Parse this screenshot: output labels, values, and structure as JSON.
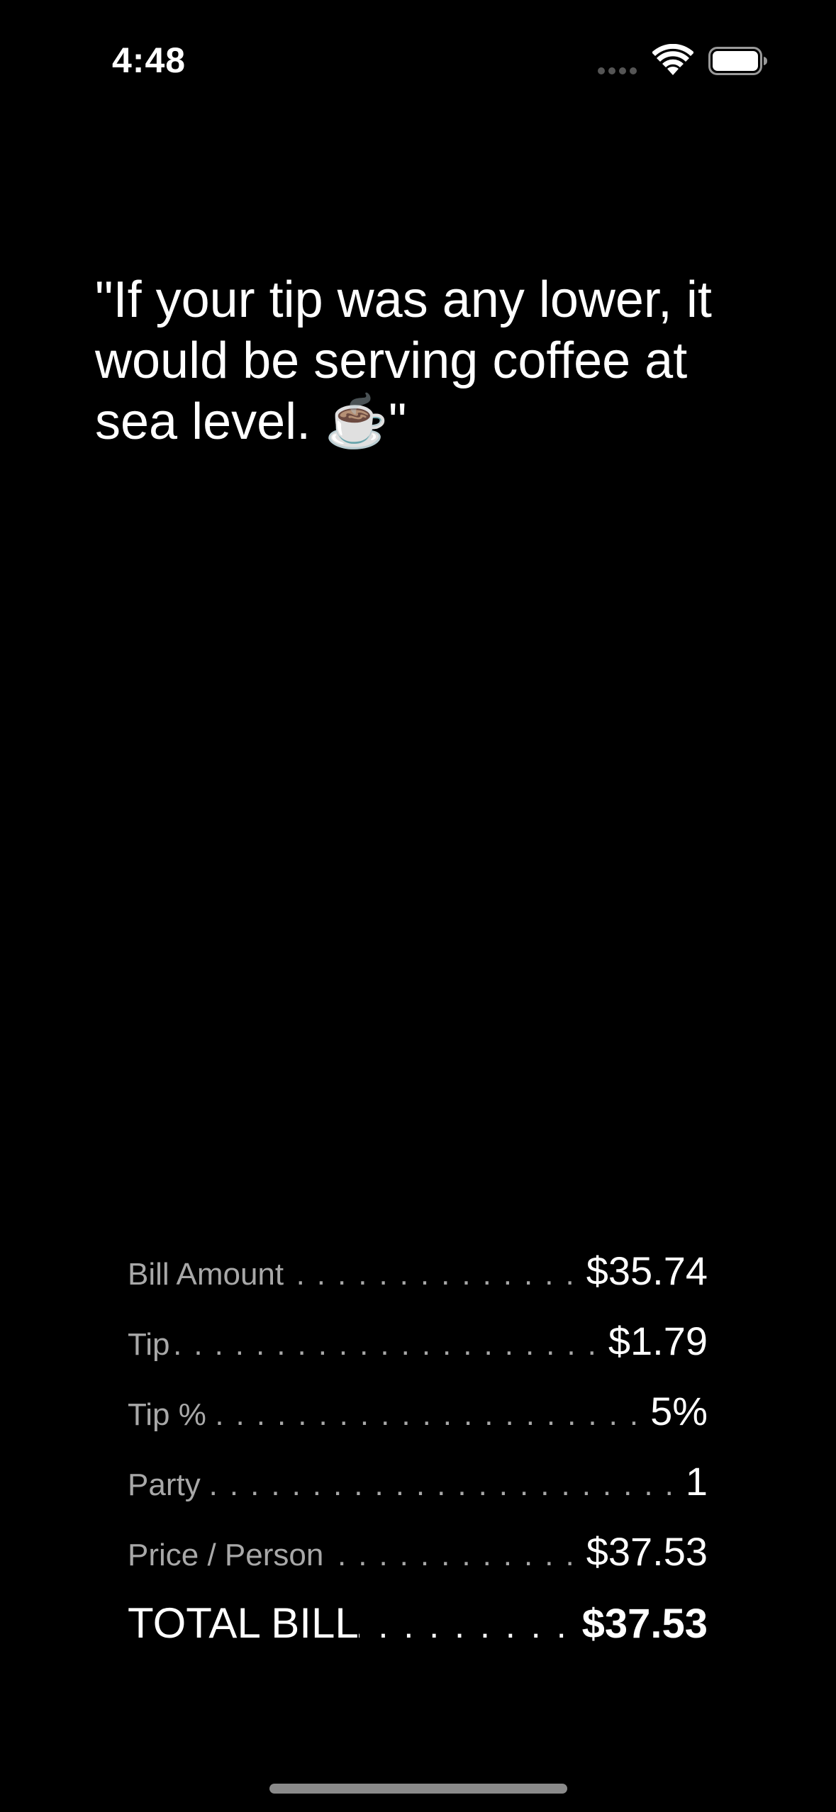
{
  "status_bar": {
    "time": "4:48",
    "icons": [
      "cellular-signal-icon",
      "wifi-icon",
      "battery-icon"
    ]
  },
  "quote": {
    "text": "\"If your tip was any lower, it would be serving coffee at sea level. ☕\""
  },
  "receipt": {
    "rows": [
      {
        "label": "Bill Amount",
        "value": "$35.74"
      },
      {
        "label": "Tip",
        "value": "$1.79"
      },
      {
        "label": "Tip %",
        "value": "5%"
      },
      {
        "label": "Party",
        "value": "1"
      },
      {
        "label": "Price / Person",
        "value": "$37.53"
      }
    ],
    "total": {
      "label": "TOTAL BILL",
      "value": "$37.53"
    }
  },
  "colors": {
    "background": "#000000",
    "primary_text": "#ffffff",
    "secondary_text": "#a8a8a8"
  }
}
